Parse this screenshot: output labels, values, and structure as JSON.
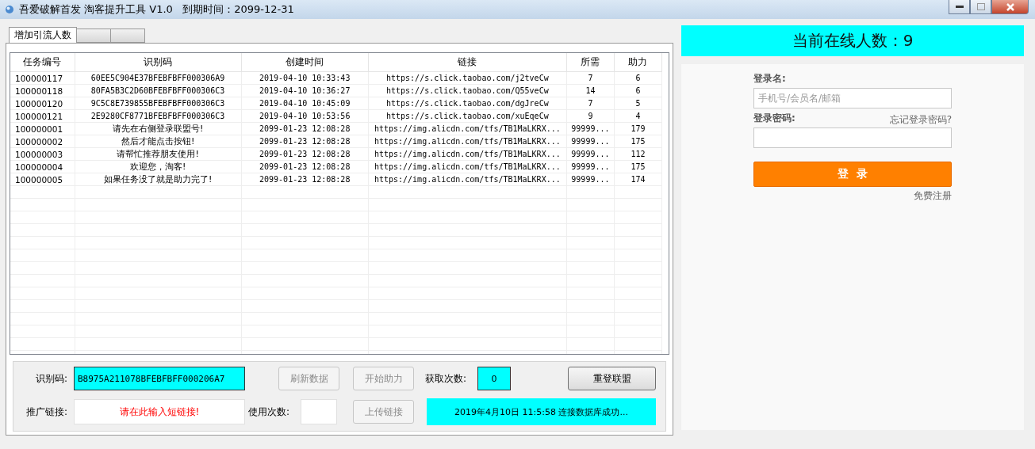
{
  "window": {
    "title": "吾爱破解首发 淘客提升工具 V1.0   到期时间：2099-12-31"
  },
  "tabs": [
    {
      "label": "增加引流人数",
      "selected": true
    },
    {
      "selected": false
    },
    {
      "selected": false
    }
  ],
  "table": {
    "columns": [
      "任务编号",
      "识别码",
      "创建时间",
      "链接",
      "所需",
      "助力"
    ],
    "rows": [
      [
        "100000117",
        "60EE5C904E37BFEBFBFF000306A9",
        "2019-04-10 10:33:43",
        "https://s.click.taobao.com/j2tveCw",
        "7",
        "6"
      ],
      [
        "100000118",
        "80FA5B3C2D60BFEBFBFF000306C3",
        "2019-04-10 10:36:27",
        "https://s.click.taobao.com/Q55veCw",
        "14",
        "6"
      ],
      [
        "100000120",
        "9C5C8E739855BFEBFBFF000306C3",
        "2019-04-10 10:45:09",
        "https://s.click.taobao.com/dgJreCw",
        "7",
        "5"
      ],
      [
        "100000121",
        "2E9280CF8771BFEBFBFF000306C3",
        "2019-04-10 10:53:56",
        "https://s.click.taobao.com/xuEqeCw",
        "9",
        "4"
      ],
      [
        "100000001",
        "请先在右侧登录联盟号!",
        "2099-01-23 12:08:28",
        "https://img.alicdn.com/tfs/TB1MaLKRX...",
        "99999...",
        "179"
      ],
      [
        "100000002",
        "然后才能点击按钮!",
        "2099-01-23 12:08:28",
        "https://img.alicdn.com/tfs/TB1MaLKRX...",
        "99999...",
        "175"
      ],
      [
        "100000003",
        "请帮忙推荐朋友使用!",
        "2099-01-23 12:08:28",
        "https://img.alicdn.com/tfs/TB1MaLKRX...",
        "99999...",
        "112"
      ],
      [
        "100000004",
        "欢迎您，淘客!",
        "2099-01-23 12:08:28",
        "https://img.alicdn.com/tfs/TB1MaLKRX...",
        "99999...",
        "175"
      ],
      [
        "100000005",
        "如果任务没了就是助力完了!",
        "2099-01-23 12:08:28",
        "https://img.alicdn.com/tfs/TB1MaLKRX...",
        "99999...",
        "174"
      ]
    ]
  },
  "controls": {
    "id_label": "识别码:",
    "id_value": "B8975A211078BFEBFBFF000206A7",
    "refresh_button": {
      "label": "刷新数据",
      "disabled": true
    },
    "start_button": {
      "label": "开始助力",
      "disabled": true
    },
    "fetch_label": "获取次数:",
    "fetch_value": "0",
    "relogin_button": {
      "label": "重登联盟",
      "disabled": false
    },
    "link_label": "推广链接:",
    "link_value": "请在此输入短链接!",
    "use_label": "使用次数:",
    "upload_button": {
      "label": "上传链接",
      "disabled": true
    },
    "status": "2019年4月10日  11:5:58  连接数据库成功..."
  },
  "online": {
    "text": "当前在线人数：9"
  },
  "login": {
    "username_label": "登录名:",
    "username_placeholder": "手机号/会员名/邮箱",
    "password_label": "登录密码:",
    "forgot_link": "忘记登录密码?",
    "submit": "登  录",
    "register_link": "免费注册"
  }
}
